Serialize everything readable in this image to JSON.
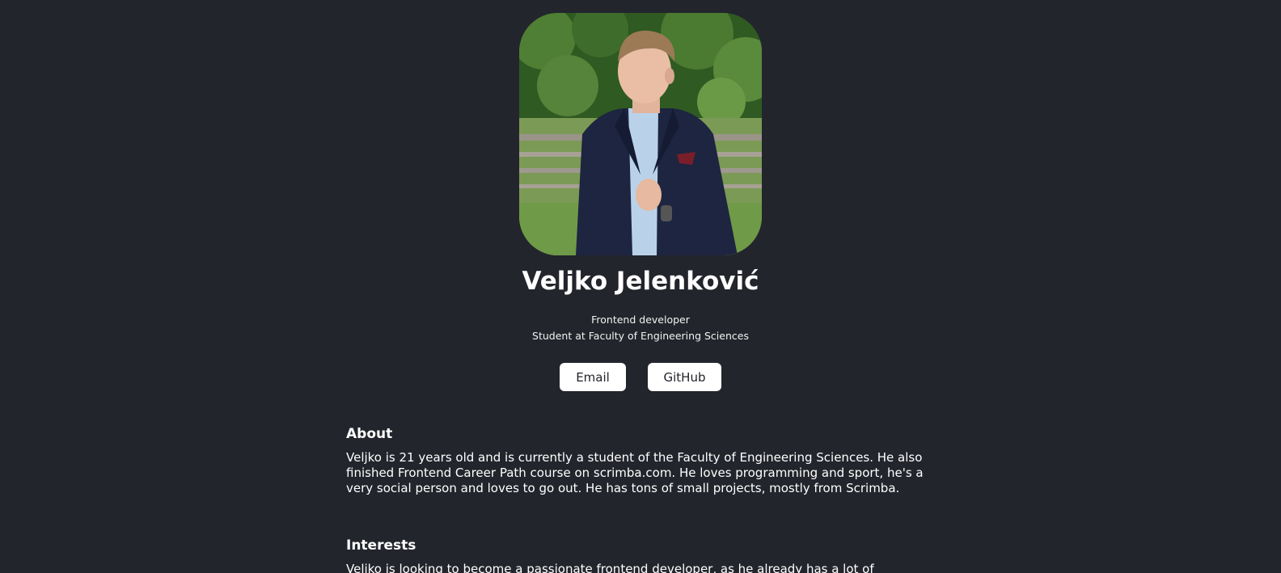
{
  "profile": {
    "photo_icon": "profile-photo",
    "name": "Veljko Jelenković",
    "role": "Frontend developer",
    "affiliation": "Student at Faculty of Engineering Sciences"
  },
  "buttons": {
    "email_label": "Email",
    "github_label": "GitHub"
  },
  "about": {
    "title": "About",
    "text": "Veljko is 21 years old and is currently a student of the Faculty of Engineering Sciences. He also finished Frontend Career Path course on scrimba.com. He loves programming and sport, he's a very social person and loves to go out. He has tons of small projects, mostly from Scrimba."
  },
  "interests": {
    "title": "Interests",
    "text": "Veljko is looking to become a passionate frontend developer, as he already has a lot of knowledge"
  },
  "colors": {
    "background": "#23252c",
    "button_bg": "#ffffff",
    "button_text": "#1f2128"
  }
}
